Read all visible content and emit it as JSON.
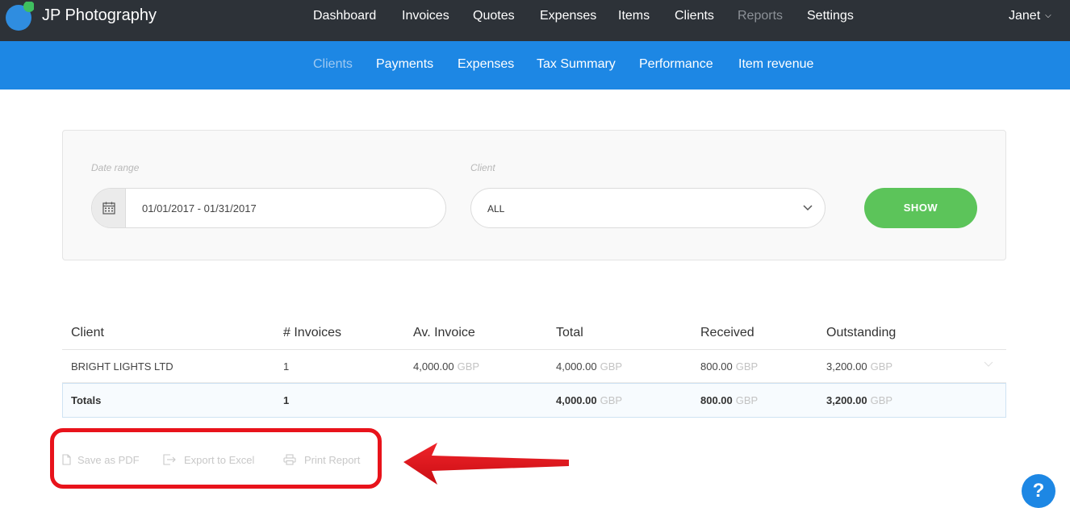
{
  "brand": {
    "name": "JP Photography"
  },
  "main_nav": [
    {
      "label": "Dashboard"
    },
    {
      "label": "Invoices"
    },
    {
      "label": "Quotes"
    },
    {
      "label": "Expenses"
    },
    {
      "label": "Items"
    },
    {
      "label": "Clients"
    },
    {
      "label": "Reports",
      "active": true
    },
    {
      "label": "Settings"
    }
  ],
  "user": {
    "name": "Janet"
  },
  "sub_nav": [
    {
      "label": "Clients",
      "active": true
    },
    {
      "label": "Payments"
    },
    {
      "label": "Expenses"
    },
    {
      "label": "Tax Summary"
    },
    {
      "label": "Performance"
    },
    {
      "label": "Item revenue"
    }
  ],
  "filters": {
    "date_label": "Date range",
    "date_value": "01/01/2017 - 01/31/2017",
    "client_label": "Client",
    "client_value": "ALL",
    "show_label": "SHOW"
  },
  "table": {
    "columns": [
      "Client",
      "# Invoices",
      "Av. Invoice",
      "Total",
      "Received",
      "Outstanding"
    ],
    "rows": [
      {
        "client": "BRIGHT LIGHTS LTD",
        "invoices": "1",
        "av_invoice": "4,000.00",
        "total": "4,000.00",
        "received": "800.00",
        "outstanding": "3,200.00"
      }
    ],
    "totals": {
      "label": "Totals",
      "invoices": "1",
      "total": "4,000.00",
      "received": "800.00",
      "outstanding": "3,200.00"
    },
    "currency": "GBP"
  },
  "actions": {
    "pdf": "Save as PDF",
    "excel": "Export to Excel",
    "print": "Print Report"
  },
  "help": {
    "label": "?"
  },
  "colors": {
    "topbar": "#2d3238",
    "subbar": "#1d87e4",
    "show_button": "#5cc45a",
    "highlight": "#e8131b",
    "link": "#2a7fd4"
  }
}
